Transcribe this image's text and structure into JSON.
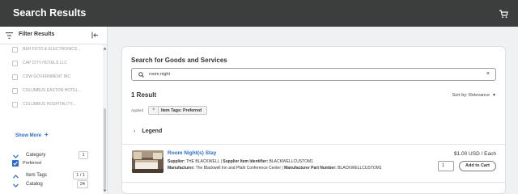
{
  "header": {
    "title": "Search Results",
    "cart_icon": "shopping-cart-icon"
  },
  "sidebar": {
    "title": "Filter Results",
    "suppliers": [
      "B&H FOTO & ELECTRONICS...",
      "CAP CITY HOTELS LLC",
      "CDW GOVERNMENT INC",
      "COLUMBUS EASTON HOTEL...",
      "COLUMBUS HOSPITALITY..."
    ],
    "show_more": "Show More",
    "show_more_plus": "+",
    "facets": {
      "category": {
        "label": "Category",
        "count": "1"
      },
      "item_tags": {
        "label": "Item Tags",
        "count": "1 / 1"
      },
      "catalog": {
        "label": "Catalog",
        "count": "24"
      }
    },
    "preferred_label": "Preferred"
  },
  "main": {
    "heading": "Search for Goods and Services",
    "search": {
      "value": "room night",
      "clear": "×"
    },
    "results_count": "1 Result",
    "sort": {
      "label": "Sort by: Relevance",
      "caret": "▼"
    },
    "applied_label": "Applied",
    "chip": {
      "x": "×",
      "label": "Item Tags: Preferred"
    },
    "legend": "Legend",
    "product": {
      "name": "Room Night(s) Stay",
      "supplier_label": "Supplier:",
      "supplier": "THE BLACKWELL",
      "supplier_id_label": "Supplier Item Identifier:",
      "supplier_id": "BLACKWELLCUSTOM1",
      "manufacturer_label": "Manufacturer:",
      "manufacturer": "The Blackwell Inn and Pfahl Conference Center",
      "part_label": "Manufacturer Part Number:",
      "part_number": "BLACKWELLCUSTOM1",
      "separator": "|",
      "price": "$1.00 USD / Each",
      "quantity": "1",
      "add_button": "Add to Cart"
    }
  },
  "colors": {
    "topbar": "#3c3e3e",
    "accent": "#2a6bd1",
    "background": "#f0f1f2"
  }
}
